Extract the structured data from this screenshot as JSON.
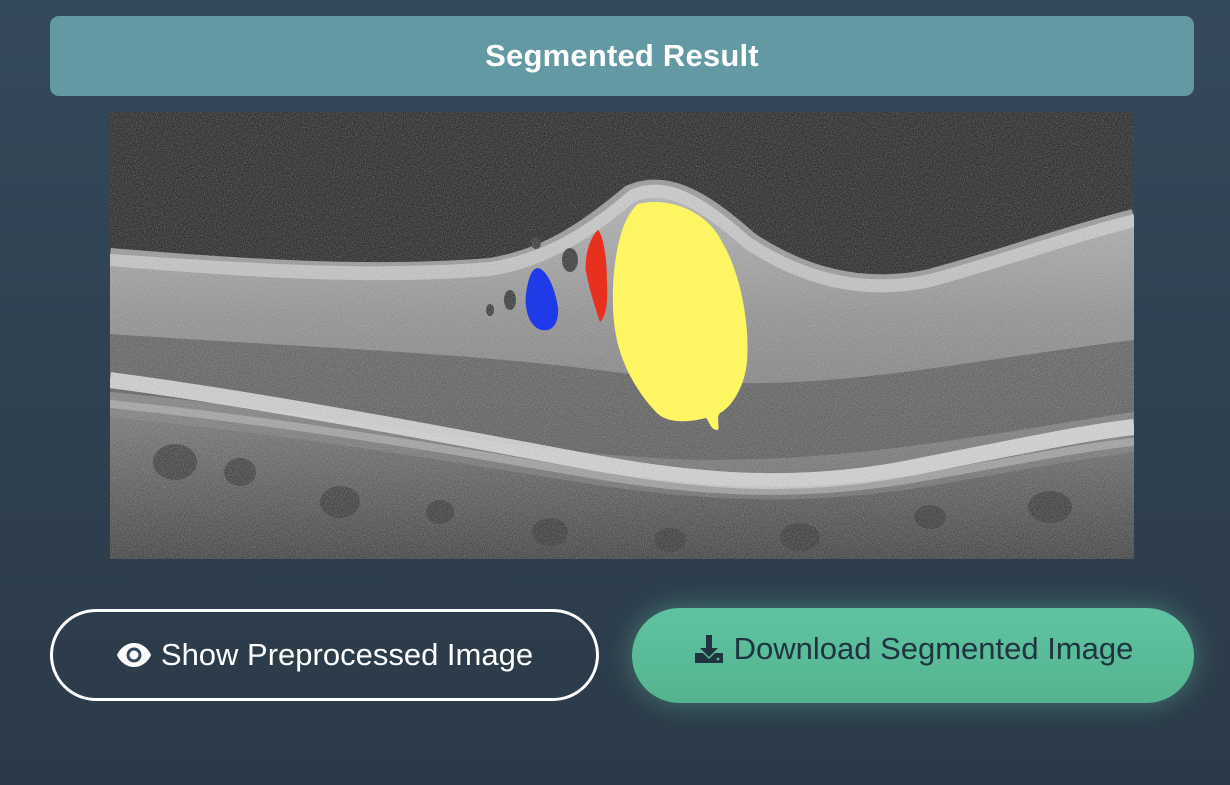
{
  "header": {
    "title": "Segmented Result"
  },
  "result_image": {
    "alt": "OCT scan with segmented regions"
  },
  "actions": {
    "show_preprocessed_label": "Show Preprocessed Image",
    "show_preprocessed_icon": "eye-icon",
    "download_label": "Download Segmented Image",
    "download_icon": "download-icon"
  },
  "colors": {
    "header_bg": "#6399a3",
    "download_bg": "#5bbc98",
    "segment_yellow": "#fdf662",
    "segment_red": "#e8301f",
    "segment_blue": "#1f3be8"
  }
}
